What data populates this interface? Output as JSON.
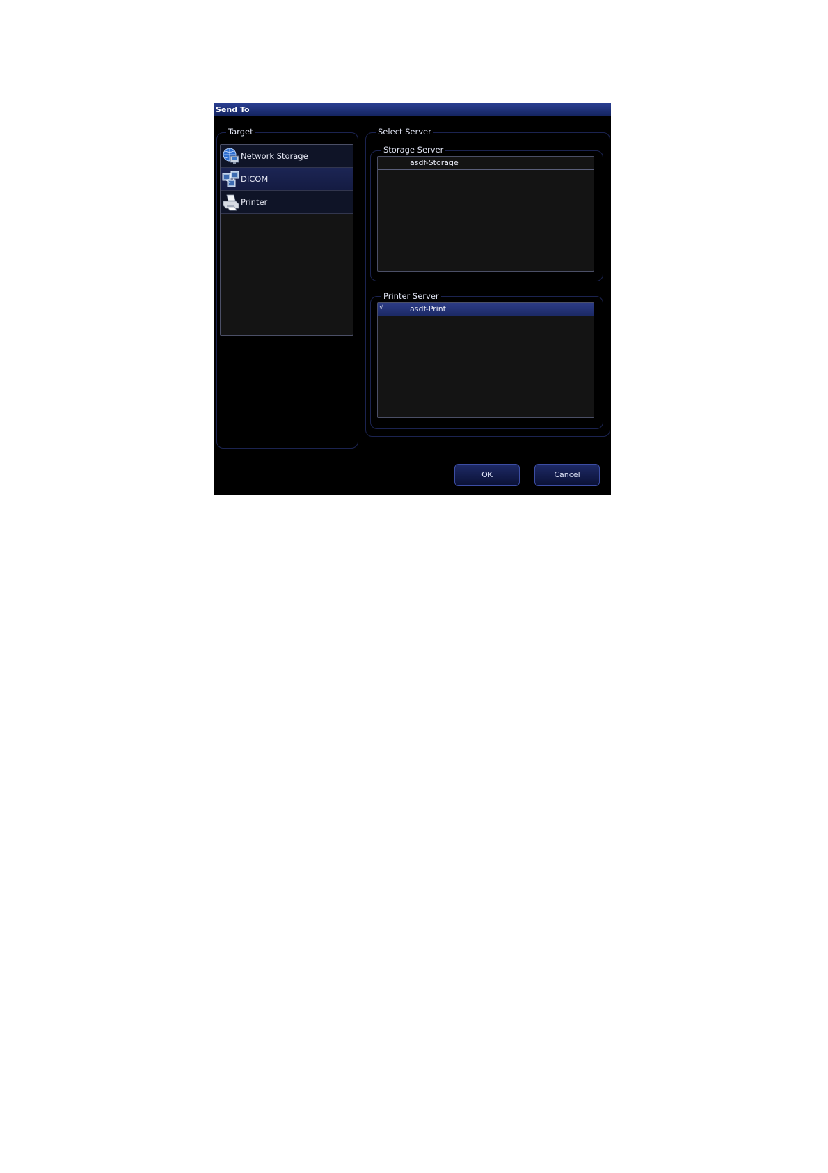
{
  "dialog": {
    "title": "Send To",
    "target": {
      "label": "Target",
      "items": [
        {
          "label": "Network Storage",
          "icon": "network-storage-icon",
          "selected": false
        },
        {
          "label": "DICOM",
          "icon": "dicom-icon",
          "selected": true
        },
        {
          "label": "Printer",
          "icon": "printer-icon",
          "selected": false
        }
      ]
    },
    "select_server": {
      "label": "Select Server",
      "storage_server": {
        "label": "Storage Server",
        "rows": [
          {
            "check": "",
            "name": "asdf-Storage",
            "selected": false
          }
        ]
      },
      "printer_server": {
        "label": "Printer Server",
        "rows": [
          {
            "check": "√",
            "name": "asdf-Print",
            "selected": true
          }
        ]
      }
    },
    "buttons": {
      "ok": "OK",
      "cancel": "Cancel"
    }
  },
  "colors": {
    "dialog_background": "#000000",
    "titlebar": "#1b2c70",
    "selection": "#1c2554",
    "button_border": "#3c4da3"
  }
}
